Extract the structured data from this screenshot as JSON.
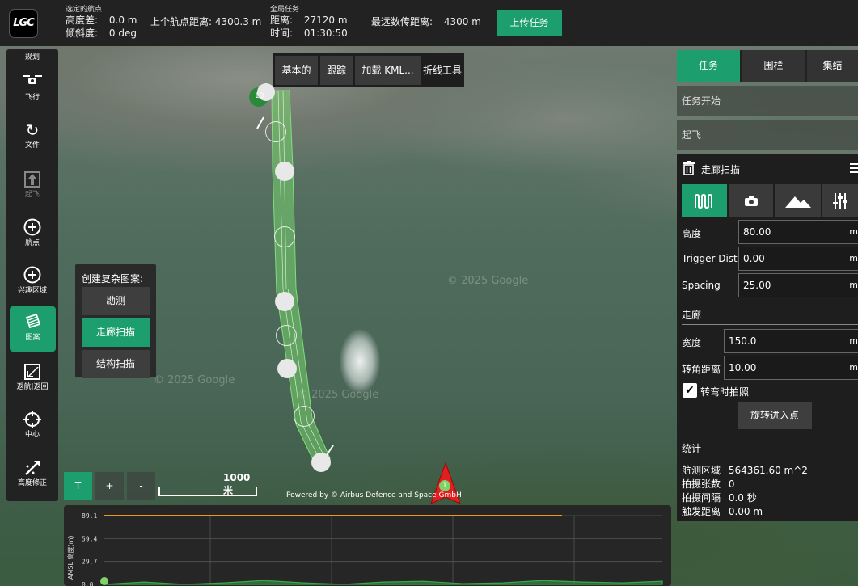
{
  "topbar": {
    "logo": "LGC",
    "selected_wp": {
      "heading": "选定的航点",
      "alt_diff_label": "高度差:",
      "alt_diff_value": "0.0 m",
      "prev_dist_label": "上个航点距离:",
      "prev_dist_value": "4300.3 m",
      "gradient_label": "倾斜度:",
      "gradient_value": "0 deg"
    },
    "mission": {
      "heading": "全局任务",
      "distance_label": "距离:",
      "distance_value": "27120 m",
      "time_label": "时间:",
      "time_value": "01:30:50",
      "max_telem_label": "最远数传距离:",
      "max_telem_value": "4300 m"
    },
    "upload_label": "上传任务"
  },
  "lefttool": {
    "items": [
      {
        "label": "规划",
        "icon": "plan-title"
      },
      {
        "label": "飞行",
        "icon": "drone-icon"
      },
      {
        "label": "文件",
        "icon": "sync-icon"
      },
      {
        "label": "起飞",
        "icon": "takeoff-icon"
      },
      {
        "label": "航点",
        "icon": "plus-circle-icon"
      },
      {
        "label": "兴趣区域",
        "icon": "plus-circle-icon"
      },
      {
        "label": "图案",
        "icon": "pattern-icon"
      },
      {
        "label": "返航|返回",
        "icon": "return-icon"
      },
      {
        "label": "中心",
        "icon": "crosshair-icon"
      },
      {
        "label": "高度修正",
        "icon": "terrain-icon"
      }
    ]
  },
  "map_buttons": [
    "基本的",
    "跟踪",
    "加载 KML...",
    "折线工具"
  ],
  "pattern_popup": {
    "title": "创建复杂图案:",
    "items": [
      "勘测",
      "走廊扫描",
      "结构扫描"
    ]
  },
  "right_panel": {
    "tabs": [
      "任务",
      "围栏",
      "集结"
    ],
    "mission_start": "任务开始",
    "takeoff": "起飞",
    "editor": {
      "title": "走廊扫描",
      "fields": [
        {
          "label": "高度",
          "value": "80.00",
          "unit": "m"
        },
        {
          "label": "Trigger Dist",
          "value": "0.00",
          "unit": "m"
        },
        {
          "label": "Spacing",
          "value": "25.00",
          "unit": "m"
        }
      ],
      "corridor_heading": "走廊",
      "corridor_fields": [
        {
          "label": "宽度",
          "value": "150.0",
          "unit": "m"
        },
        {
          "label": "转角距离",
          "value": "10.00",
          "unit": "m"
        }
      ],
      "photo_in_turn": "转弯时拍照",
      "rotate_entry": "旋转进入点",
      "stats_heading": "统计",
      "stats": [
        {
          "label": "航测区域",
          "value": "564361.60 m^2"
        },
        {
          "label": "拍摄张数",
          "value": "0"
        },
        {
          "label": "拍摄间隔",
          "value": "0.0 秒"
        },
        {
          "label": "触发距离",
          "value": "0.00 m"
        }
      ]
    }
  },
  "map": {
    "zoom_buttons": [
      "T",
      "+",
      "-"
    ],
    "scale_label": "1000 米",
    "watermark": "© 2025 Google",
    "powered": "Powered by © Airbus Defence and Space GmbH",
    "waypoint_number": "13",
    "home_number": "1"
  },
  "chart_data": {
    "type": "area",
    "title": "",
    "ylabel": "AMSL 高度(m)",
    "y_ticks": [
      "89.1",
      "59.4",
      "29.7",
      "0.0"
    ],
    "ylim": [
      0,
      89.1
    ],
    "series": [
      {
        "values": [
          89.1,
          89.1
        ],
        "color": "#e89a1c"
      },
      {
        "values": [
          0,
          3,
          0,
          2,
          5,
          2,
          0,
          3,
          4,
          1,
          2,
          5,
          3,
          2,
          4
        ],
        "color": "#3aa84a"
      }
    ]
  }
}
